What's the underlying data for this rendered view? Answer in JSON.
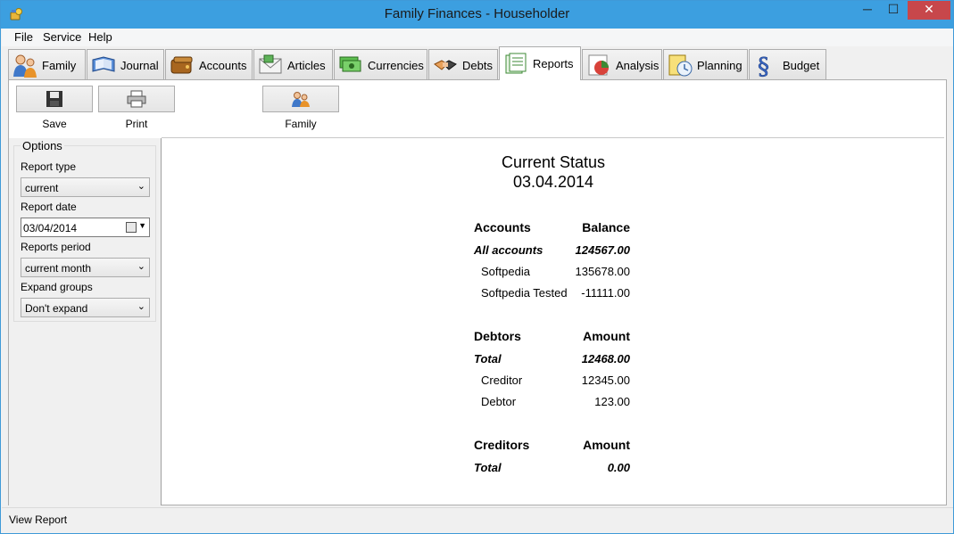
{
  "window": {
    "title": "Family Finances - Householder",
    "min": "─",
    "max": "☐",
    "close": "✕"
  },
  "menu": [
    "File",
    "Service",
    "Help"
  ],
  "tabs": [
    {
      "label": "Family",
      "icon": "family-icon",
      "active": false
    },
    {
      "label": "Journal",
      "icon": "journal-icon",
      "active": false
    },
    {
      "label": "Accounts",
      "icon": "wallet-icon",
      "active": false
    },
    {
      "label": "Articles",
      "icon": "envelope-icon",
      "active": false
    },
    {
      "label": "Currencies",
      "icon": "money-icon",
      "active": false
    },
    {
      "label": "Debts",
      "icon": "handshake-icon",
      "active": false
    },
    {
      "label": "Reports",
      "icon": "report-icon",
      "active": true
    },
    {
      "label": "Analysis",
      "icon": "pie-chart-icon",
      "active": false
    },
    {
      "label": "Planning",
      "icon": "clock-icon",
      "active": false
    },
    {
      "label": "Budget",
      "icon": "paragraph-icon",
      "active": false
    }
  ],
  "toolbar": {
    "save": "Save",
    "print": "Print",
    "family": "Family"
  },
  "options": {
    "title": "Options",
    "report_type_label": "Report type",
    "report_type": "current",
    "report_date_label": "Report date",
    "report_date": "03/04/2014",
    "period_label": "Reports period",
    "period": "current month",
    "expand_label": "Expand groups",
    "expand": "Don't expand"
  },
  "report": {
    "title": "Current Status",
    "date": "03.04.2014",
    "accounts": {
      "header": "Accounts",
      "value_header": "Balance",
      "total_label": "All accounts",
      "total": "124567.00",
      "rows": [
        {
          "name": "Softpedia",
          "value": "135678.00"
        },
        {
          "name": "Softpedia Tested",
          "value": "-11111.00"
        }
      ]
    },
    "debtors": {
      "header": "Debtors",
      "value_header": "Amount",
      "total_label": "Total",
      "total": "12468.00",
      "rows": [
        {
          "name": "Creditor",
          "value": "12345.00"
        },
        {
          "name": "Debtor",
          "value": "123.00"
        }
      ]
    },
    "creditors": {
      "header": "Creditors",
      "value_header": "Amount",
      "total_label": "Total",
      "total": "0.00"
    }
  },
  "status": "View Report"
}
